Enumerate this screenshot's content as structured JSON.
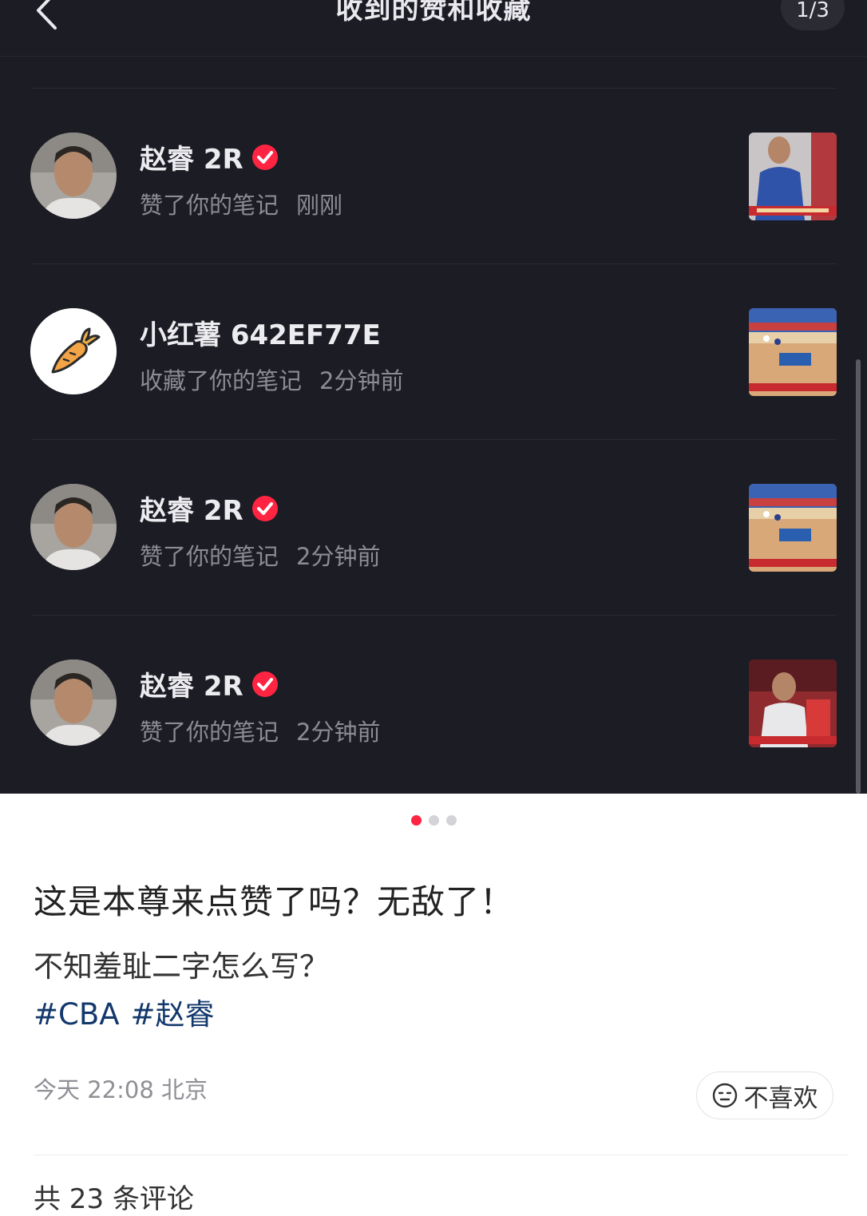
{
  "header": {
    "title": "收到的赞和收藏",
    "page_counter": "1/3"
  },
  "notifications": [
    {
      "user": "赵睿 2R",
      "verified": true,
      "action": "赞了你的笔记",
      "time": "刚刚",
      "avatar": "person-avatar",
      "thumbnail": "player-closeup"
    },
    {
      "user": "小红薯 642EF77E",
      "verified": false,
      "action": "收藏了你的笔记",
      "time": "2分钟前",
      "avatar": "carrot-avatar",
      "thumbnail": "basketball-court"
    },
    {
      "user": "赵睿 2R",
      "verified": true,
      "action": "赞了你的笔记",
      "time": "2分钟前",
      "avatar": "person-avatar",
      "thumbnail": "basketball-court"
    },
    {
      "user": "赵睿 2R",
      "verified": true,
      "action": "赞了你的笔记",
      "time": "2分钟前",
      "avatar": "person-avatar",
      "thumbnail": "player-closeup"
    }
  ],
  "carousel": {
    "count": 3,
    "active": 0
  },
  "post": {
    "title": "这是本尊来点赞了吗？无敌了！",
    "body": "不知羞耻二字怎么写？",
    "tags": [
      "#CBA",
      "#赵睿"
    ],
    "meta": "今天 22:08 北京",
    "dislike_label": "不喜欢",
    "comments_partial": "共 23 条评论"
  },
  "colors": {
    "dark_bg": "#1c1c24",
    "verified_badge": "#ff2442",
    "tag_text": "#13386c",
    "active_dot": "#ff2442"
  }
}
